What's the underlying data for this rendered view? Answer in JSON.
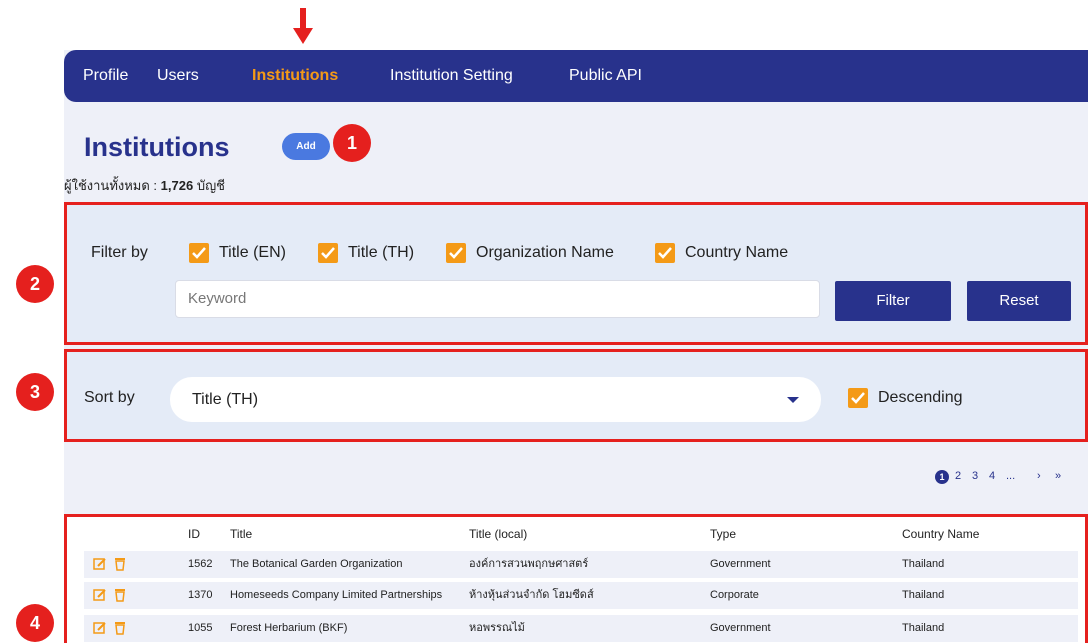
{
  "nav": {
    "items": [
      "Profile",
      "Users",
      "Institutions",
      "Institution Setting",
      "Public API"
    ],
    "active": "Institutions"
  },
  "header": {
    "title": "Institutions",
    "add_label": "Add",
    "summary_prefix": "ผู้ใช้งานทั้งหมด :",
    "summary_count": "1,726",
    "summary_suffix": "บัญชี"
  },
  "annotations": [
    "1",
    "2",
    "3",
    "4"
  ],
  "filter": {
    "label": "Filter by",
    "options": [
      "Title (EN)",
      "Title (TH)",
      "Organization Name",
      "Country Name"
    ],
    "keyword_placeholder": "Keyword",
    "filter_label": "Filter",
    "reset_label": "Reset"
  },
  "sort": {
    "label": "Sort by",
    "selected": "Title (TH)",
    "descending_label": "Descending"
  },
  "pagination": {
    "pages": [
      "1",
      "2",
      "3",
      "4",
      "...",
      "›",
      "»"
    ],
    "current": "1"
  },
  "table": {
    "columns": [
      "ID",
      "Title",
      "Title (local)",
      "Type",
      "Country Name"
    ],
    "rows": [
      [
        "1562",
        "The Botanical Garden Organization",
        "องค์การสวนพฤกษศาสตร์",
        "Government",
        "Thailand"
      ],
      [
        "1370",
        "Homeseeds Company Limited Partnerships",
        "ห้างหุ้นส่วนจำกัด โฮมซีดส์",
        "Corporate",
        "Thailand"
      ],
      [
        "1055",
        "Forest Herbarium (BKF)",
        "หอพรรณไม้",
        "Government",
        "Thailand"
      ]
    ]
  },
  "colors": {
    "brand": "#28328c",
    "accent": "#f49a17",
    "annotation": "#e5201e",
    "add_button": "#4a79e0"
  },
  "icons": [
    "arrow-down-icon",
    "check-icon",
    "chevron-down-icon",
    "edit-icon",
    "trash-icon"
  ]
}
